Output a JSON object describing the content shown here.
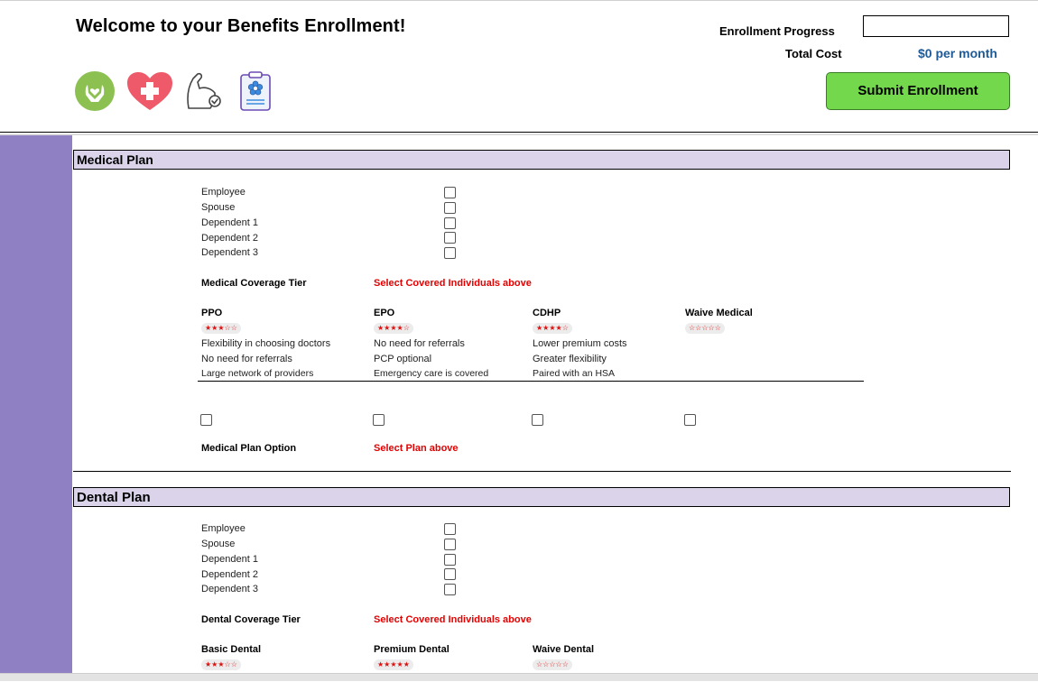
{
  "header": {
    "title": "Welcome to your Benefits Enrollment!",
    "progress_label": "Enrollment Progress",
    "cost_label": "Total Cost",
    "cost_value": "$0 per month",
    "submit_label": "Submit Enrollment"
  },
  "icons": [
    "caring-hands-icon",
    "heart-plus-icon",
    "flexed-arm-icon",
    "clipboard-icon"
  ],
  "medical": {
    "title": "Medical Plan",
    "individuals": [
      "Employee",
      "Spouse",
      "Dependent 1",
      "Dependent 2",
      "Dependent 3"
    ],
    "tier_label": "Medical Coverage Tier",
    "tier_value": "Select Covered Individuals above",
    "plans": [
      {
        "name": "PPO",
        "stars": "★★★☆☆",
        "features": [
          "Flexibility in choosing doctors",
          "No need for referrals",
          "Large network of providers"
        ]
      },
      {
        "name": "EPO",
        "stars": "★★★★☆",
        "features": [
          "No need for referrals",
          "PCP optional",
          "Emergency care is covered"
        ]
      },
      {
        "name": "CDHP",
        "stars": "★★★★☆",
        "features": [
          "Lower premium costs",
          "Greater flexibility",
          "Paired with an HSA"
        ]
      },
      {
        "name": "Waive Medical",
        "stars": "☆☆☆☆☆",
        "features": []
      }
    ],
    "option_label": "Medical Plan Option",
    "option_value": "Select Plan above"
  },
  "dental": {
    "title": "Dental Plan",
    "individuals": [
      "Employee",
      "Spouse",
      "Dependent 1",
      "Dependent 2",
      "Dependent 3"
    ],
    "tier_label": "Dental Coverage Tier",
    "tier_value": "Select Covered Individuals above",
    "plans": [
      {
        "name": "Basic Dental",
        "stars": "★★★☆☆"
      },
      {
        "name": "Premium Dental",
        "stars": "★★★★★"
      },
      {
        "name": "Waive Dental",
        "stars": "☆☆☆☆☆"
      }
    ]
  },
  "colors": {
    "sidebar": "#8f80c4",
    "section_header": "#dad3ea",
    "submit": "#73d84c",
    "cost": "#1e5a96",
    "alert": "#e60000"
  }
}
